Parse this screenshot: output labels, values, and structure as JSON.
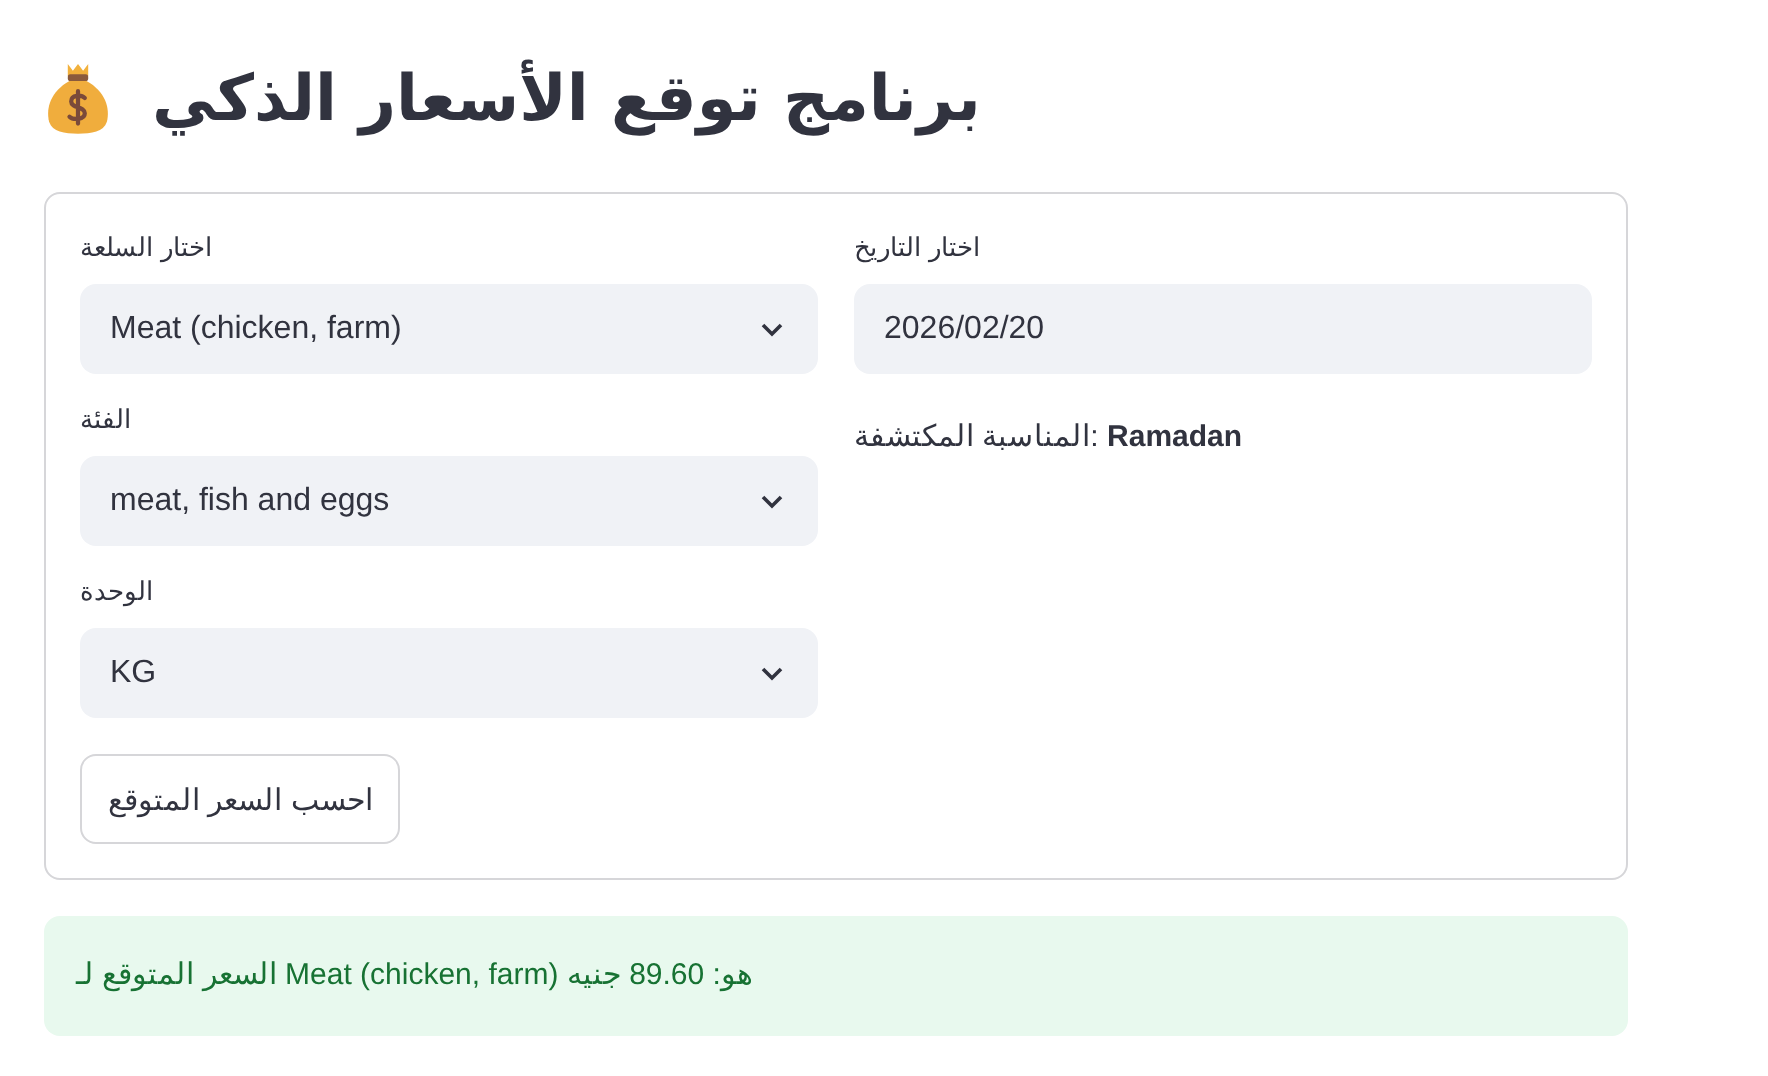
{
  "title": "برنامج توقع الأسعار الذكي",
  "form": {
    "commodity": {
      "label": "اختار السلعة",
      "value": "Meat (chicken, farm)"
    },
    "date": {
      "label": "اختار التاريخ",
      "value": "2026/02/20"
    },
    "category": {
      "label": "الفئة",
      "value": "meat, fish and eggs"
    },
    "occasion": "المناسبة المكتشفة: **Ramadan**",
    "unit": {
      "label": "الوحدة",
      "value": "KG"
    },
    "button": "احسب السعر المتوقع"
  },
  "result": "السعر المتوقع لـ Meat (chicken, farm) هو: 89.60 جنيه"
}
